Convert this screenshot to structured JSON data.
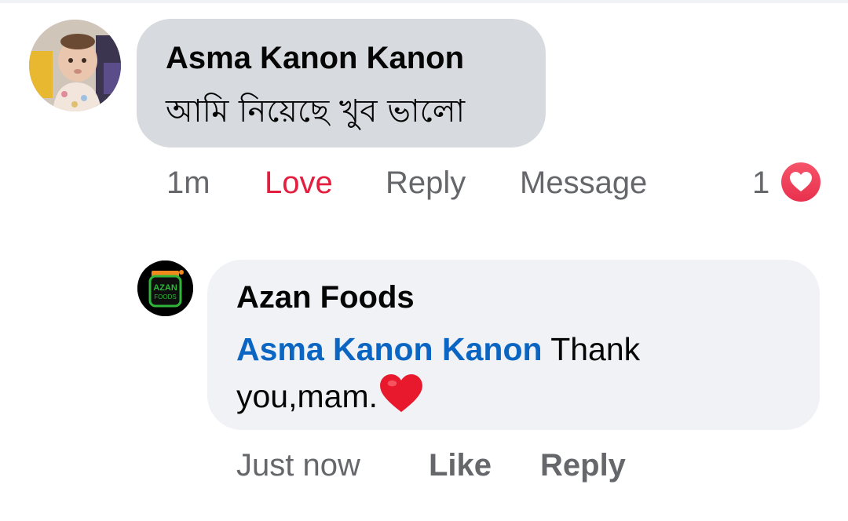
{
  "comment": {
    "author": "Asma Kanon Kanon",
    "text": "আমি নিয়েছে খুব ভালো",
    "time": "1m",
    "actions": {
      "love": "Love",
      "reply": "Reply",
      "message": "Message"
    },
    "reaction_count": "1",
    "reaction_icon": "heart-reaction-icon",
    "love_color": "#e41e3f"
  },
  "reply": {
    "author": "Azan Foods",
    "mention": "Asma Kanon Kanon",
    "text": " Thank you,mam.",
    "emoji": "red-heart-emoji",
    "time": "Just now",
    "actions": {
      "like": "Like",
      "reply": "Reply"
    },
    "mention_color": "#0a66c2",
    "avatar_logo_lines": [
      "AZAN",
      "FOODS"
    ]
  }
}
